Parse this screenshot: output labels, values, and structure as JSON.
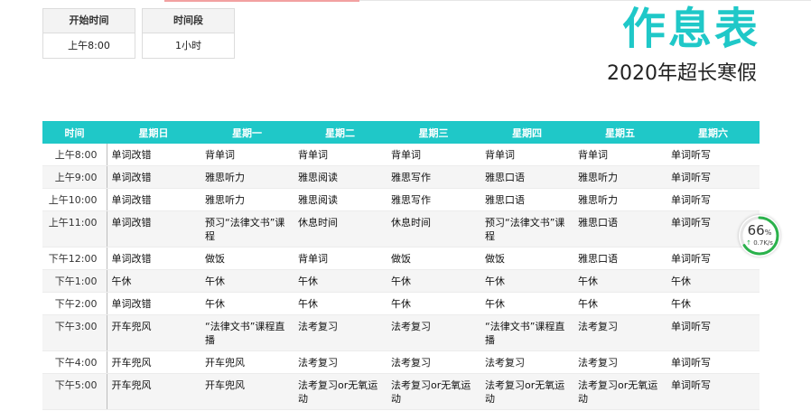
{
  "accent": "#1fc8c8",
  "settings": {
    "start_label": "开始时间",
    "start_value": "上午8:00",
    "period_label": "时间段",
    "period_value": "1小时"
  },
  "title": "作息表",
  "subtitle": "2020年超长寒假",
  "table": {
    "headers": [
      "时间",
      "星期日",
      "星期一",
      "星期二",
      "星期三",
      "星期四",
      "星期五",
      "星期六"
    ],
    "rows": [
      {
        "time": "上午8:00",
        "cells": [
          "单词改错",
          "背单词",
          "背单词",
          "背单词",
          "背单词",
          "背单词",
          "单词听写"
        ]
      },
      {
        "time": "上午9:00",
        "cells": [
          "单词改错",
          "雅思听力",
          "雅思阅读",
          "雅思写作",
          "雅思口语",
          "雅思听力",
          "单词听写"
        ]
      },
      {
        "time": "上午10:00",
        "cells": [
          "单词改错",
          "雅思听力",
          "雅思阅读",
          "雅思写作",
          "雅思口语",
          "雅思听力",
          "单词听写"
        ]
      },
      {
        "time": "上午11:00",
        "cells": [
          "单词改错",
          "预习“法律文书”课程",
          "休息时间",
          "休息时间",
          "预习“法律文书”课程",
          "雅思口语",
          "单词听写"
        ]
      },
      {
        "time": "下午12:00",
        "cells": [
          "单词改错",
          "做饭",
          "背单词",
          "做饭",
          "做饭",
          "雅思口语",
          "单词听写"
        ]
      },
      {
        "time": "下午1:00",
        "cells": [
          "午休",
          "午休",
          "午休",
          "午休",
          "午休",
          "午休",
          "午休"
        ]
      },
      {
        "time": "下午2:00",
        "cells": [
          "单词改错",
          "午休",
          "午休",
          "午休",
          "午休",
          "午休",
          "午休"
        ]
      },
      {
        "time": "下午3:00",
        "cells": [
          "开车兜风",
          "“法律文书”课程直播",
          "法考复习",
          "法考复习",
          "“法律文书”课程直播",
          "法考复习",
          "单词听写"
        ]
      },
      {
        "time": "下午4:00",
        "cells": [
          "开车兜风",
          "开车兜风",
          "法考复习",
          "法考复习",
          "法考复习",
          "法考复习",
          "单词听写"
        ]
      },
      {
        "time": "下午5:00",
        "cells": [
          "开车兜风",
          "开车兜风",
          "法考复习or无氧运动",
          "法考复习or无氧运动",
          "法考复习or无氧运动",
          "法考复习or无氧运动",
          "单词听写"
        ]
      }
    ]
  },
  "speed_widget": {
    "percent": "66",
    "percent_unit": "%",
    "percent_value": 66,
    "rate": "0.7K/s",
    "ring_color": "#2bb24c"
  }
}
